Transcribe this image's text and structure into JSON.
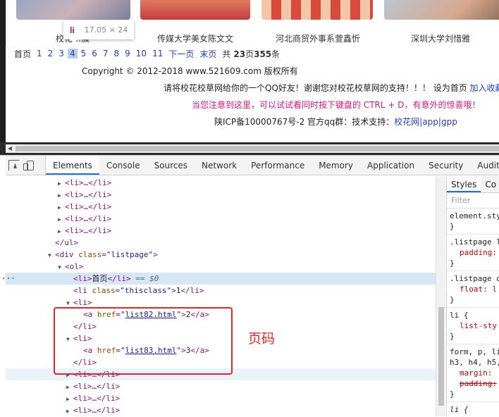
{
  "webpage": {
    "thumbs": [
      {
        "caption": "校花…簇"
      },
      {
        "caption": "传媒大学美女陈文文"
      },
      {
        "caption": "河北商贸外事系萱鑫忻"
      },
      {
        "caption": "深圳大学刘惜雅"
      }
    ],
    "tooltip": {
      "tag": "li",
      "size": "17.05 × 24"
    },
    "pager": {
      "first": "首页",
      "pages": [
        "1",
        "2",
        "3"
      ],
      "current": "4",
      "more_pages": [
        "5",
        "6",
        "7",
        "8",
        "9",
        "10",
        "11"
      ],
      "next": "下一页",
      "last": "末页",
      "total_prefix": "共",
      "total_pages": "23",
      "page_unit": "页",
      "total_items": "355",
      "item_unit": "条"
    },
    "footer": {
      "copyright": "Copyright © 2012-2018 www.521609.com 版权所有",
      "share_text": "请将校花校草网给你的一个QQ好友！谢谢您对校花校草网的支持！！！ 设为首页",
      "favorite": "加入收藏",
      "tip": "当您注意到这里，可以试试看同时按下键盘的 CTRL + D，有意外的惊喜哦！",
      "icp": "陕ICP备10000767号-2 官方qq群：技术支持：",
      "sites": "校花网",
      "sep1": "|",
      "app": "app",
      "sep2": "|",
      "gpp": "gpp"
    }
  },
  "devtools": {
    "tabs": [
      "Elements",
      "Console",
      "Sources",
      "Network",
      "Performance",
      "Memory",
      "Application",
      "Security",
      "Audits"
    ],
    "active_tab": "Elements",
    "dom": {
      "collapsed_li": "<li>…</li>",
      "ul_close": "</ul>",
      "div_open_tag": "<div",
      "div_class_attr": "class",
      "div_class_val": "\"listpage\"",
      "ol_open": "<ol>",
      "li_open": "<li>",
      "li_close": "</li>",
      "first_text": "首页",
      "selected_marker": "== $0",
      "class_attr": "class",
      "thisclass_val": "\"thisclass\"",
      "thisclass_text": "1",
      "a_open": "<a",
      "href_attr": "href",
      "href2": "list82.html",
      "link2_text": "2",
      "href3": "list83.html",
      "link3_text": "3",
      "a_close": "</a>",
      "gt": ">",
      "quote": "\"",
      "eq": "="
    },
    "annotation": "页码",
    "styles": {
      "tabs": [
        "Styles",
        "Co"
      ],
      "filter_placeholder": "Filter",
      "rules": [
        {
          "selector": "element.sty",
          "lines": [],
          "close": "}"
        },
        {
          "selector": ".listpage l",
          "lines": [
            "padding:"
          ],
          "close": "}"
        },
        {
          "selector": ".listpage o",
          "lines": [
            "float: l"
          ],
          "close": "}"
        },
        {
          "selector": "li {",
          "lines": [
            "list-sty"
          ],
          "close": "}"
        },
        {
          "selector": "form, p, li",
          "selector2": "h3, h4, h5,",
          "lines": [
            "margin:"
          ],
          "struck": [
            "padding:"
          ],
          "close": "}"
        },
        {
          "selector": "li {",
          "lines": [],
          "close": ""
        }
      ]
    }
  }
}
